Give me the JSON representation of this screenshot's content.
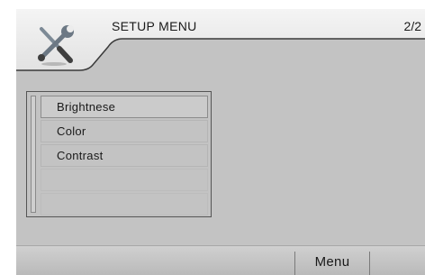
{
  "header": {
    "title": "SETUP MENU",
    "page_indicator": "2/2",
    "icon": "tools-icon"
  },
  "menu": {
    "items": [
      {
        "label": "Brightnese",
        "selected": true
      },
      {
        "label": "Color",
        "selected": false
      },
      {
        "label": "Contrast",
        "selected": false
      },
      {
        "label": "",
        "selected": false
      },
      {
        "label": "",
        "selected": false
      }
    ]
  },
  "footer": {
    "menu_label": "Menu"
  },
  "colors": {
    "background": "#c3c3c3",
    "header_band": "#ebebeb",
    "text": "#1a1a1a"
  }
}
